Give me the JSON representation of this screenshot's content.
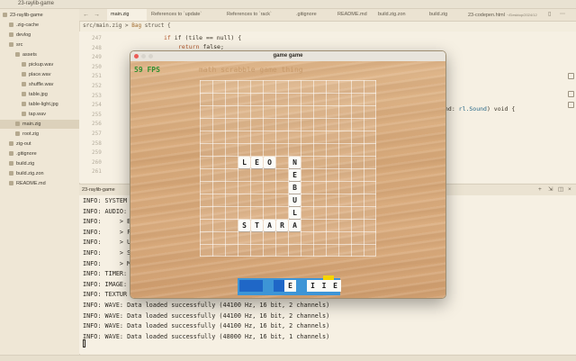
{
  "app": {
    "title": "23-raylib-game"
  },
  "sidebar": {
    "items": [
      {
        "label": "23-raylib-game",
        "indent": 0
      },
      {
        "label": ".zig-cache",
        "indent": 1
      },
      {
        "label": "devlog",
        "indent": 1
      },
      {
        "label": "src",
        "indent": 1
      },
      {
        "label": "assets",
        "indent": 2
      },
      {
        "label": "pickup.wav",
        "indent": 3
      },
      {
        "label": "place.wav",
        "indent": 3
      },
      {
        "label": "shuffle.wav",
        "indent": 3
      },
      {
        "label": "table.jpg",
        "indent": 3
      },
      {
        "label": "table-light.jpg",
        "indent": 3
      },
      {
        "label": "tap.wav",
        "indent": 3
      },
      {
        "label": "main.zig",
        "indent": 2,
        "selected": true
      },
      {
        "label": "root.zig",
        "indent": 2
      },
      {
        "label": "zig-out",
        "indent": 1
      },
      {
        "label": ".gitignore",
        "indent": 1
      },
      {
        "label": "build.zig",
        "indent": 1
      },
      {
        "label": "build.zig.zon",
        "indent": 1
      },
      {
        "label": "README.md",
        "indent": 1
      }
    ]
  },
  "tabs": [
    {
      "label": "main.zig",
      "active": true
    },
    {
      "label": "References to `update`"
    },
    {
      "label": "References to `rack`"
    },
    {
      "label": ".gitignore"
    },
    {
      "label": "README.md"
    },
    {
      "label": "build.zig.zon"
    },
    {
      "label": "build.zig"
    },
    {
      "label": "23-codepen.html",
      "hint": "~/Desktop/2024/12"
    }
  ],
  "editor": {
    "breadcrumb": {
      "file": "src/main.zig",
      "sep": ">",
      "symbol_kw": "Bag",
      "symbol_rest": "struct {"
    },
    "line_numbers": [
      "247",
      "248",
      "249",
      "250",
      "251",
      "252",
      "253",
      "254",
      "255",
      "256",
      "257",
      "258",
      "259",
      "260",
      "261"
    ],
    "lines": [
      {
        "indent": "if (tile == null) {"
      },
      {
        "kw": "return",
        "rest": " false;"
      }
    ],
    "fragment_right": {
      "pre": "nd: ",
      "ty": "rl.Sound",
      "post": ") void {"
    }
  },
  "terminal": {
    "tab_label": "23-raylib-game",
    "lines": [
      "INFO: SYSTEM",
      "INFO: AUDIO:",
      "INFO:     > B",
      "INFO:     > F",
      "INFO:     > U",
      "INFO:     > S",
      "INFO:     > M",
      "INFO: TIMER:",
      "INFO: IMAGE:",
      "INFO: TEXTUR",
      "INFO: WAVE: Data loaded successfully (44100 Hz, 16 bit, 2 channels)",
      "INFO: WAVE: Data loaded successfully (44100 Hz, 16 bit, 2 channels)",
      "INFO: WAVE: Data loaded successfully (44100 Hz, 16 bit, 2 channels)",
      "INFO: WAVE: Data loaded successfully (48000 Hz, 16 bit, 1 channels)"
    ]
  },
  "game": {
    "window_title": "game game",
    "fps": "59 FPS",
    "title": "math scrabble game thing",
    "words": [
      {
        "letters": [
          "L",
          "E",
          "O"
        ],
        "dir": "across",
        "col": 3,
        "row": 6
      },
      {
        "letters": [
          "N",
          "E",
          "B",
          "U",
          "L",
          "A"
        ],
        "dir": "down",
        "col": 7,
        "row": 6
      },
      {
        "letters": [
          "S",
          "T",
          "A",
          "R"
        ],
        "dir": "across",
        "col": 3,
        "row": 11
      }
    ],
    "rack": [
      {
        "letter": "",
        "kind": "blue"
      },
      {
        "letter": "",
        "kind": "blue"
      },
      {
        "letter": "",
        "kind": "gap"
      },
      {
        "letter": "",
        "kind": "blue"
      },
      {
        "letter": "E",
        "kind": "white"
      },
      {
        "letter": "",
        "kind": "gap"
      },
      {
        "letter": "I",
        "kind": "white"
      },
      {
        "letter": "I",
        "kind": "white"
      },
      {
        "letter": "E",
        "kind": "white"
      }
    ],
    "colors": {
      "fps": "#2f8f2f",
      "rack": "#3d95d6",
      "rack_slot": "#1f67c7",
      "highlight": "#f5d400"
    }
  }
}
